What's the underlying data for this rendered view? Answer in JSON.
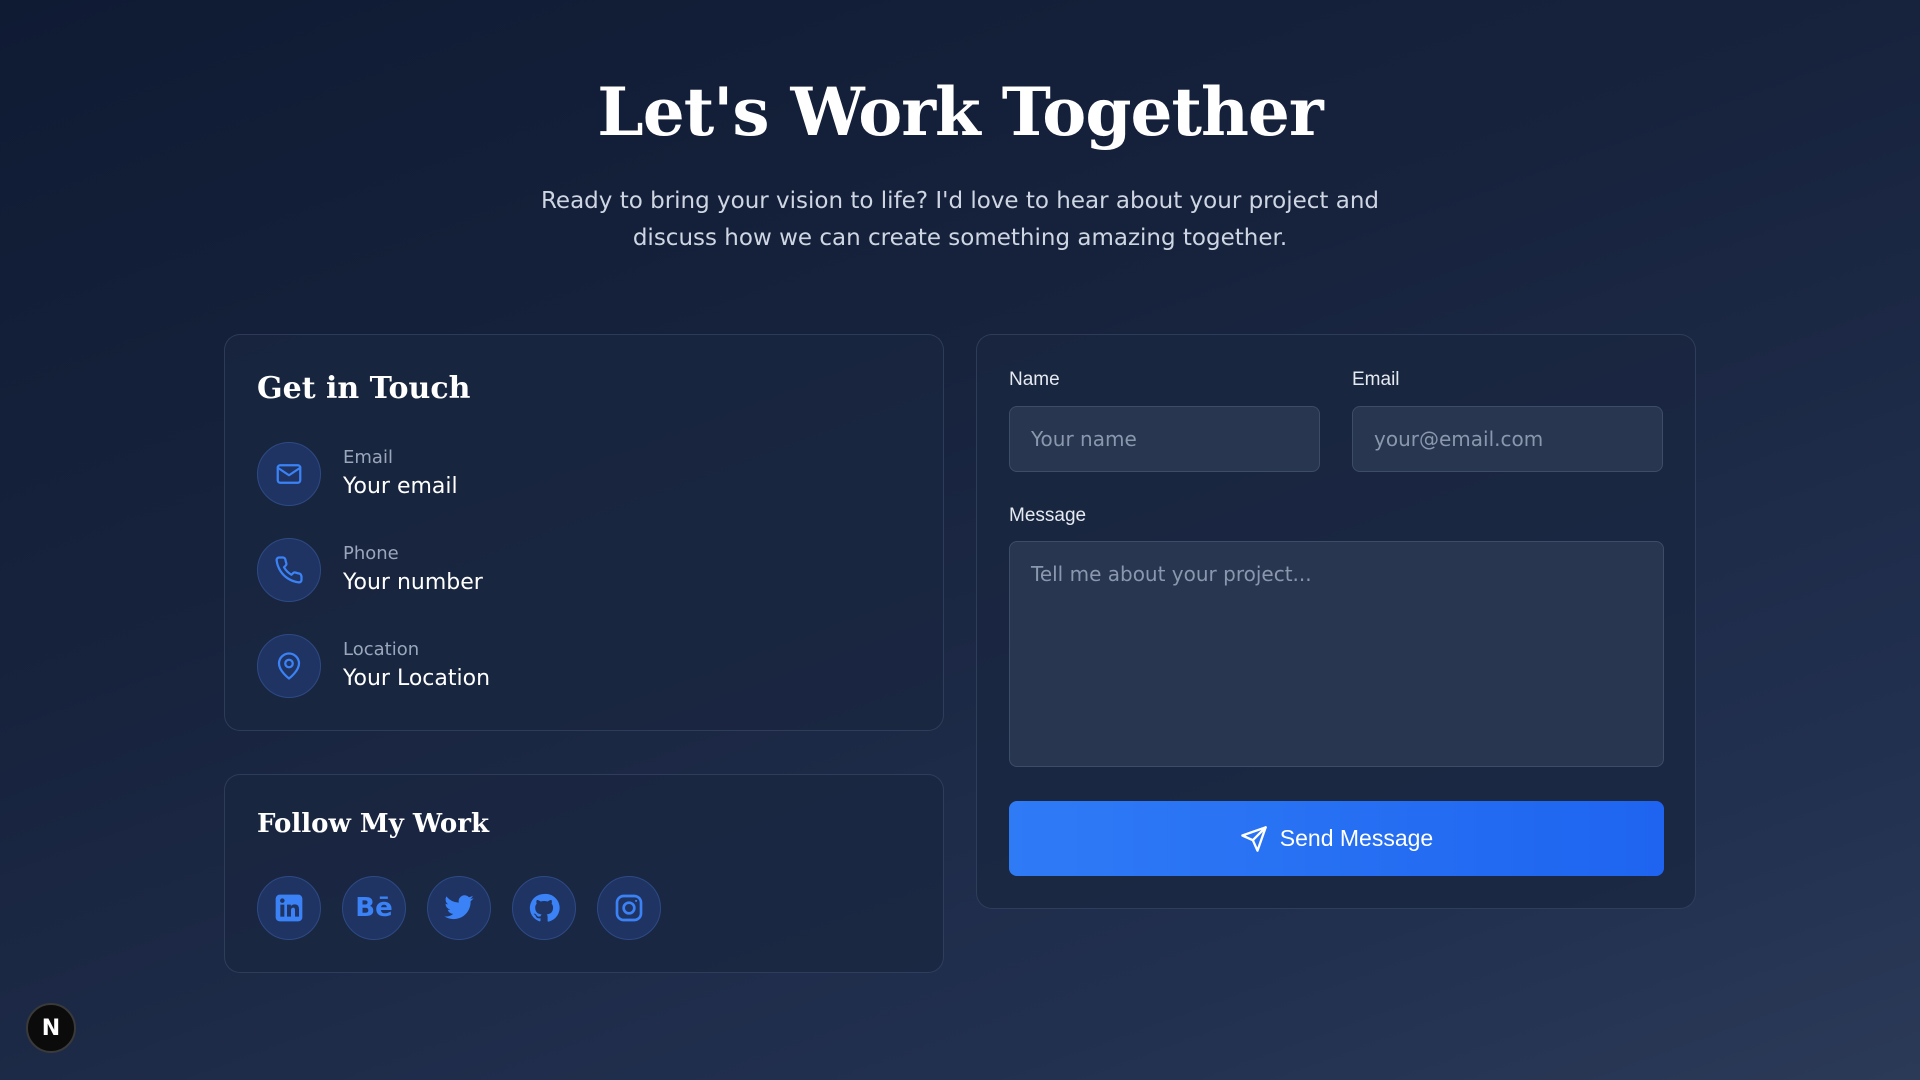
{
  "hero": {
    "title": "Let's Work Together",
    "subtitle": "Ready to bring your vision to life? I'd love to hear about your project and discuss how we can create something amazing together."
  },
  "contact": {
    "heading": "Get in Touch",
    "items": [
      {
        "icon": "mail-icon",
        "label": "Email",
        "value": "Your email"
      },
      {
        "icon": "phone-icon",
        "label": "Phone",
        "value": "Your number"
      },
      {
        "icon": "map-pin-icon",
        "label": "Location",
        "value": "Your Location"
      }
    ]
  },
  "social": {
    "heading": "Follow My Work",
    "links": [
      {
        "icon": "linkedin-icon"
      },
      {
        "icon": "behance-icon",
        "glyph": "Bē"
      },
      {
        "icon": "twitter-icon"
      },
      {
        "icon": "github-icon"
      },
      {
        "icon": "instagram-icon"
      }
    ]
  },
  "form": {
    "name_label": "Name",
    "name_placeholder": "Your name",
    "email_label": "Email",
    "email_placeholder": "your@email.com",
    "message_label": "Message",
    "message_placeholder": "Tell me about your project...",
    "submit_label": "Send Message"
  },
  "badge": {
    "letter": "N"
  },
  "colors": {
    "accent": "#3b82f6",
    "button": "#2370f4",
    "card_bg": "#1a2640",
    "background": "#17233d"
  }
}
